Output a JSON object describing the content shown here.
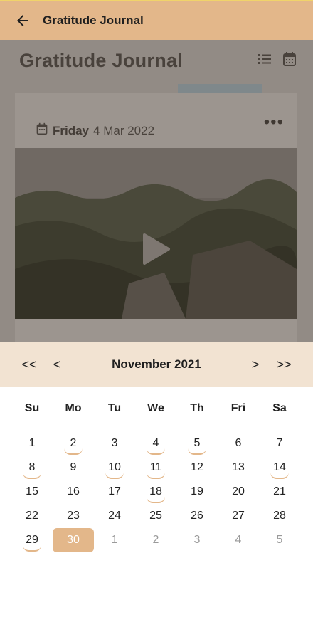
{
  "topbar": {
    "title": "Gratitude Journal",
    "back_icon": "arrow-left-icon"
  },
  "page": {
    "title": "Gratitude Journal",
    "icons": [
      "list-icon",
      "calendar-icon"
    ],
    "card": {
      "day": "Friday",
      "date": "4 Mar 2022",
      "menu": "•••"
    }
  },
  "calendar": {
    "month": "November 2021",
    "nav": {
      "prev_year": "<<",
      "prev_month": "<",
      "next_month": ">",
      "next_year": ">>"
    },
    "weekdays": [
      "Su",
      "Mo",
      "Tu",
      "We",
      "Th",
      "Fri",
      "Sa"
    ],
    "weeks": [
      [
        {
          "d": "1"
        },
        {
          "d": "2",
          "m": true
        },
        {
          "d": "3"
        },
        {
          "d": "4",
          "m": true
        },
        {
          "d": "5",
          "m": true
        },
        {
          "d": "6"
        },
        {
          "d": "7"
        }
      ],
      [
        {
          "d": "8",
          "m": true
        },
        {
          "d": "9"
        },
        {
          "d": "10",
          "m": true
        },
        {
          "d": "11",
          "m": true
        },
        {
          "d": "12"
        },
        {
          "d": "13"
        },
        {
          "d": "14",
          "m": true
        }
      ],
      [
        {
          "d": "15"
        },
        {
          "d": "16"
        },
        {
          "d": "17"
        },
        {
          "d": "18",
          "m": true
        },
        {
          "d": "19"
        },
        {
          "d": "20"
        },
        {
          "d": "21"
        }
      ],
      [
        {
          "d": "22"
        },
        {
          "d": "23"
        },
        {
          "d": "24"
        },
        {
          "d": "25"
        },
        {
          "d": "26"
        },
        {
          "d": "27"
        },
        {
          "d": "28"
        }
      ],
      [
        {
          "d": "29",
          "m": true
        },
        {
          "d": "30",
          "sel": true
        },
        {
          "d": "1",
          "o": true
        },
        {
          "d": "2",
          "o": true
        },
        {
          "d": "3",
          "o": true
        },
        {
          "d": "4",
          "o": true
        },
        {
          "d": "5",
          "o": true
        }
      ]
    ]
  },
  "colors": {
    "accent": "#e3b78a",
    "nav_bg": "#f2e3d2",
    "other_month": "#9a9a9a"
  }
}
